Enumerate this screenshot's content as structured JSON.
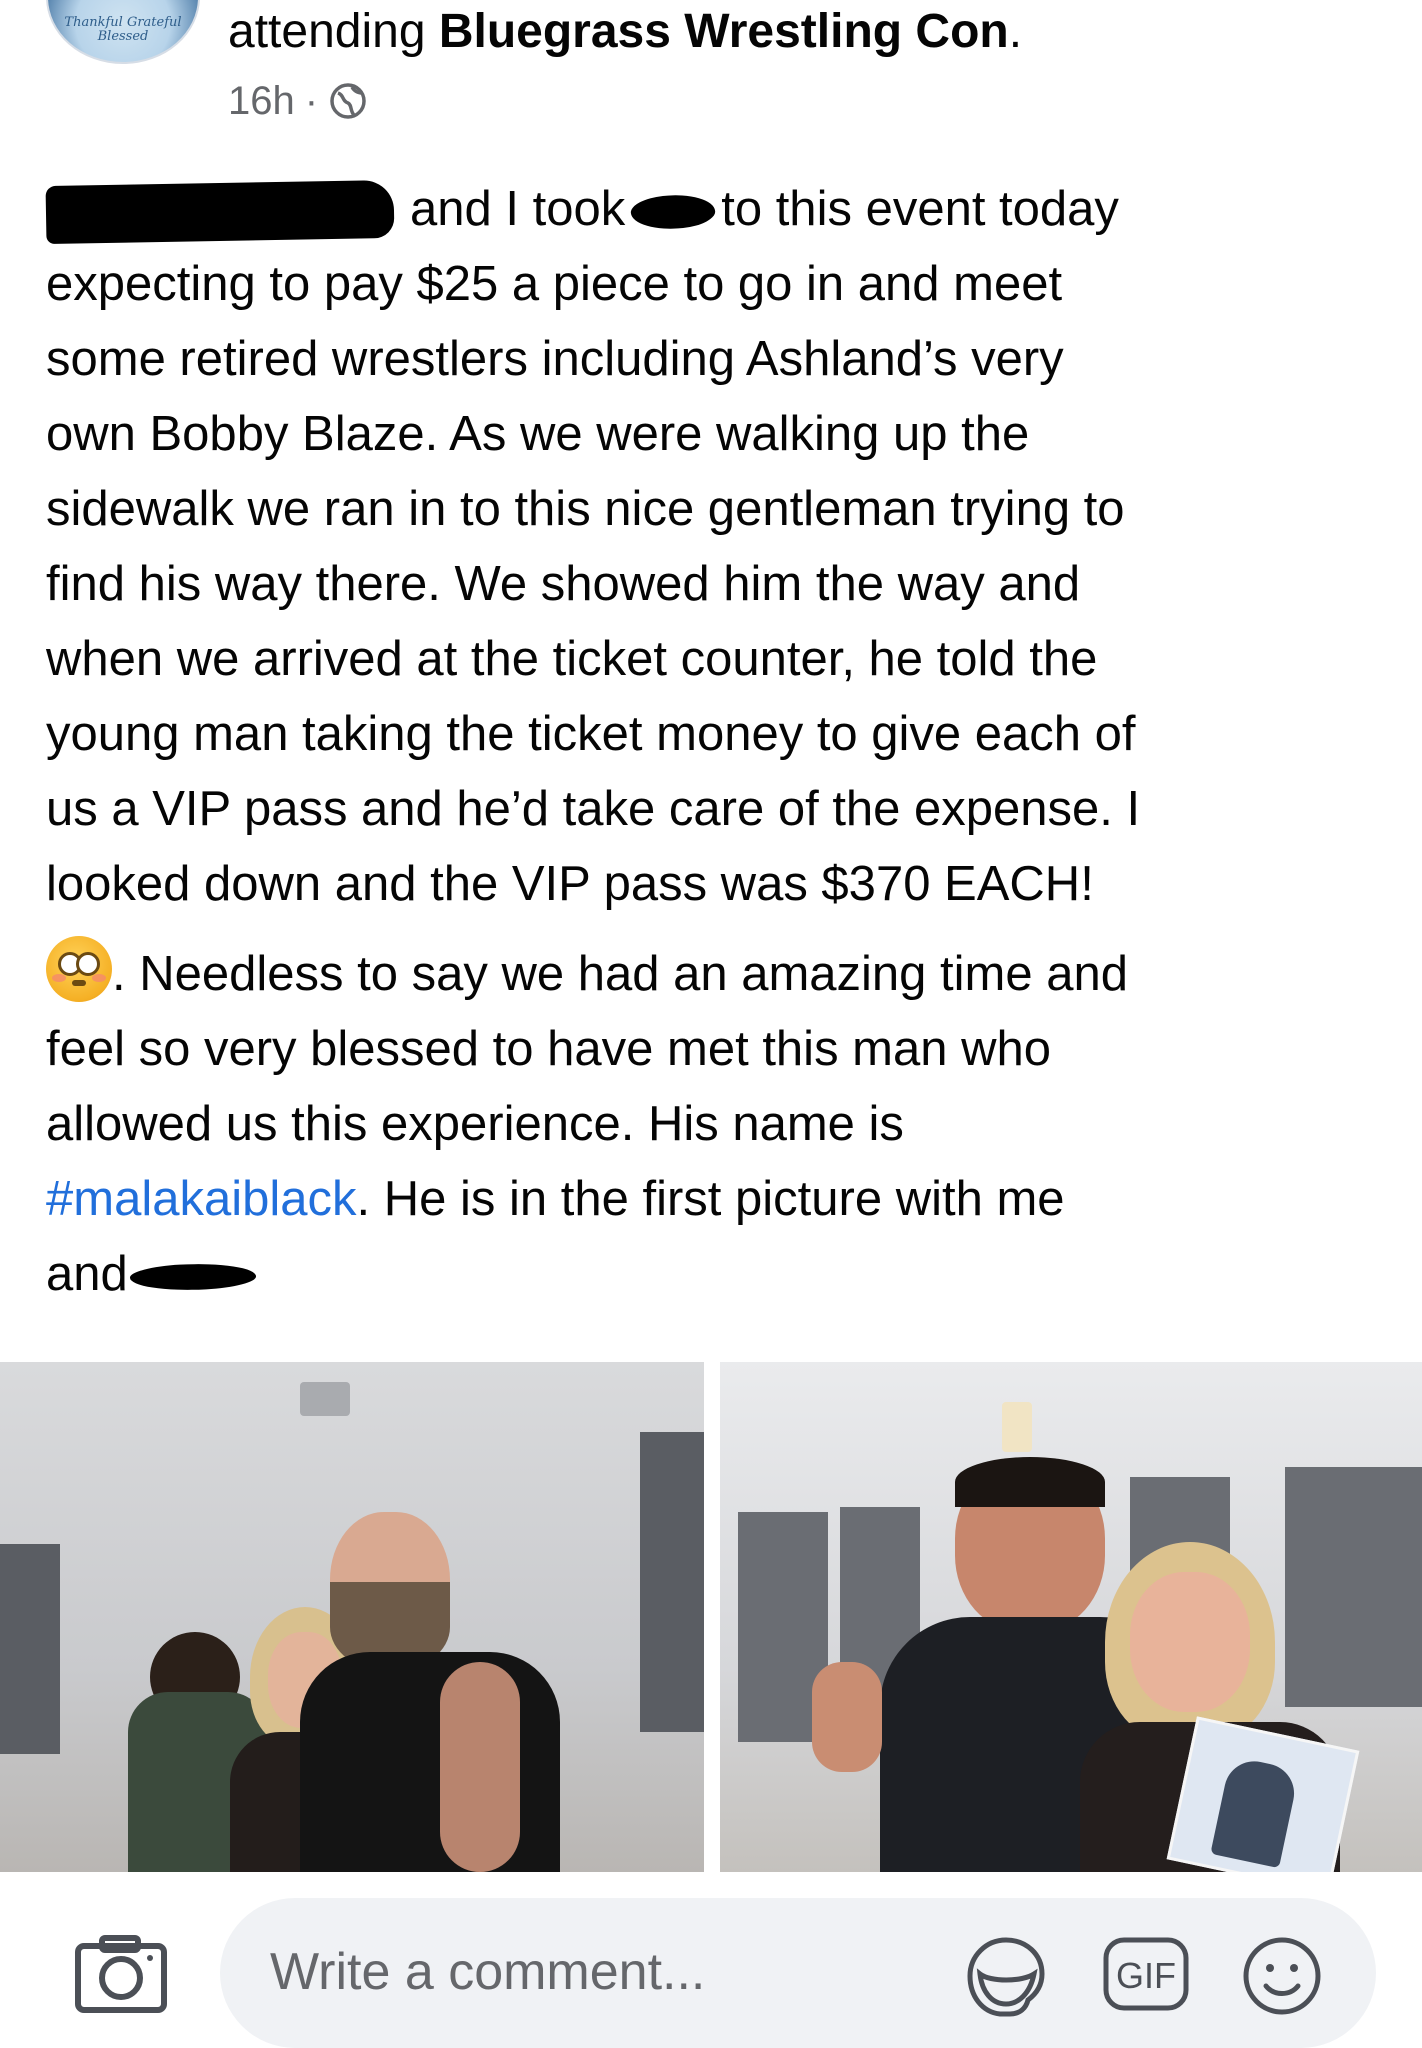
{
  "header": {
    "avatar_text": "Thankful Grateful Blessed",
    "attending_prefix": "attending ",
    "place": "Bluegrass Wrestling Con",
    "period": ".",
    "time": "16h",
    "separator": "·"
  },
  "post": {
    "line1_after_redaction": "and I took",
    "line1_rest": "to this event today",
    "lines_block1": [
      "expecting to pay $25 a piece to go in and meet",
      "some retired wrestlers including Ashland’s very",
      "own Bobby Blaze. As we were walking up the",
      "sidewalk we ran in to this nice gentleman trying to",
      "find his way there. We showed him the way and",
      "when we arrived at the ticket counter, he told the",
      "young man taking the ticket money to give each of",
      "us a VIP pass and he’d take care of the expense. I",
      "looked down and the VIP pass was $370 EACH!"
    ],
    "emoji_line_rest": ". Needless to say we had an amazing time and",
    "lines_block2": [
      "feel so very blessed to have met this man who",
      "allowed us this experience. His name is"
    ],
    "hashtag": "#malakaiblack",
    "after_hashtag": ".  He is in the first picture with me",
    "last_line": "and"
  },
  "comment_bar": {
    "placeholder": "Write a comment...",
    "gif_label": "GIF"
  },
  "colors": {
    "link": "#216fdb",
    "secondary_text": "#65676b",
    "input_bg": "#f0f2f5"
  }
}
